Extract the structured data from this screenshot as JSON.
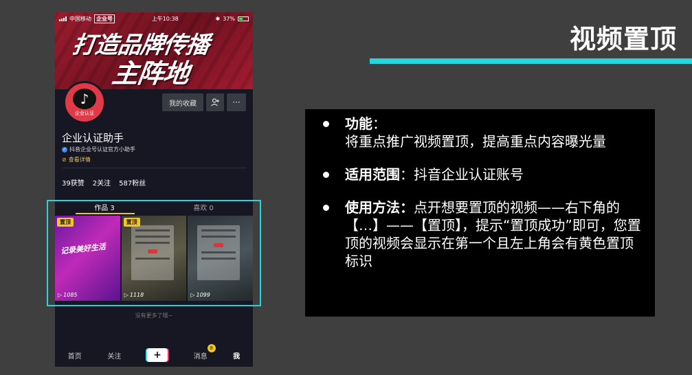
{
  "slide": {
    "title": "视频置顶",
    "accent_color": "#22d7e0"
  },
  "phone": {
    "status": {
      "carrier": "中国移动",
      "app_tag": "企业号",
      "time": "上午10:38",
      "battery": "37%"
    },
    "banner": {
      "line1": "打造品牌传播",
      "line2": "主阵地"
    },
    "avatar_label": "企业认证",
    "buttons": {
      "favorites": "我的收藏",
      "add_friend_icon": "add-user-icon",
      "more": "···"
    },
    "profile": {
      "name": "企业认证助手",
      "verification": "抖音企业号认证官方小助手",
      "details_link": "查看详情"
    },
    "stats": {
      "likes": "39获赞",
      "following": "2关注",
      "followers": "587粉丝"
    },
    "tabs": {
      "works": "作品 3",
      "likes": "喜欢 0"
    },
    "videos": [
      {
        "pin": "置顶",
        "text": "记录美好生活",
        "count": "1085"
      },
      {
        "pin": "置顶",
        "count": "1118"
      },
      {
        "count": "1099"
      }
    ],
    "no_more": "没有更多了哦~",
    "nav": {
      "home": "首页",
      "follow": "关注",
      "plus": "+",
      "messages": "消息",
      "messages_badge": "8",
      "me": "我"
    }
  },
  "info": {
    "items": [
      {
        "label": "功能",
        "sep": "：",
        "text": "将重点推广视频置顶，提高重点内容曝光量"
      },
      {
        "label": "适用范围",
        "sep": "：",
        "text": "抖音企业认证账号"
      },
      {
        "label": "使用方法：",
        "sep": "",
        "text": "点开想要置顶的视频——右下角的【…】——【置顶】，提示“置顶成功”即可，您置顶的视频会显示在第一个且左上角会有黄色置顶标识"
      }
    ]
  }
}
